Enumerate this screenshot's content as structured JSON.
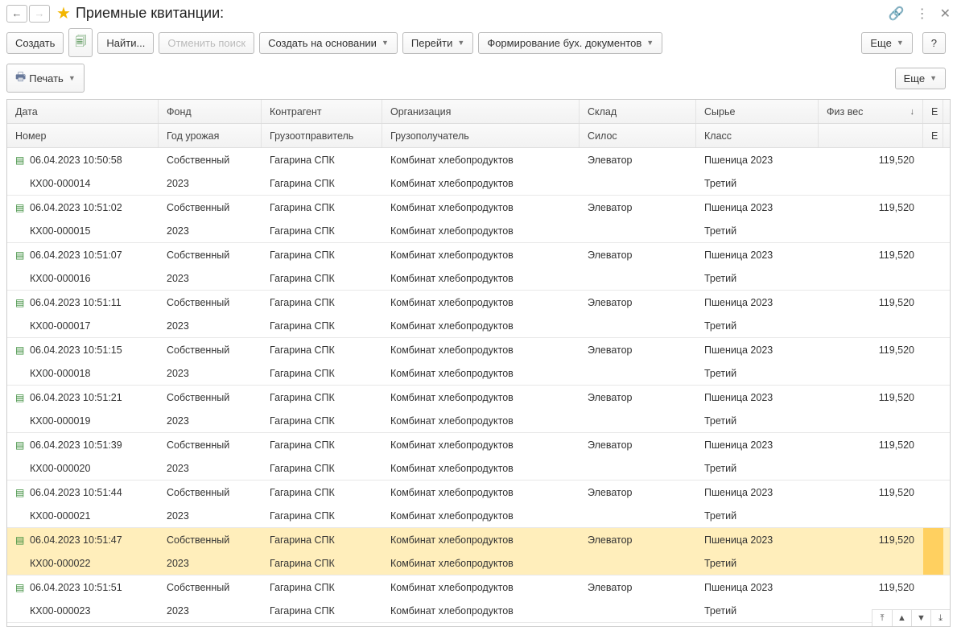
{
  "title": "Приемные квитанции:",
  "toolbar": {
    "create": "Создать",
    "find": "Найти...",
    "cancel_search": "Отменить поиск",
    "create_based": "Создать на основании",
    "goto": "Перейти",
    "form_docs": "Формирование бух. документов",
    "more": "Еще",
    "help": "?",
    "print": "Печать"
  },
  "headers": {
    "row1": {
      "c1": "Дата",
      "c2": "Фонд",
      "c3": "Контрагент",
      "c4": "Организация",
      "c5": "Склад",
      "c6": "Сырье",
      "c7": "Физ вес",
      "c8": "Е"
    },
    "row2": {
      "c1": "Номер",
      "c2": "Год урожая",
      "c3": "Грузоотправитель",
      "c4": "Грузополучатель",
      "c5": "Силос",
      "c6": "Класс",
      "c7": "",
      "c8": "Е"
    }
  },
  "rows": [
    {
      "date": "06.04.2023 10:50:58",
      "num": "КХ00-000014",
      "fund": "Собственный",
      "year": "2023",
      "counterparty": "Гагарина СПК",
      "sender": "Гагарина СПК",
      "org": "Комбинат хлебопродуктов",
      "receiver": "Комбинат хлебопродуктов",
      "warehouse": "Элеватор",
      "silo": "",
      "raw": "Пшеница 2023",
      "cls": "Третий",
      "weight": "119,520",
      "selected": false
    },
    {
      "date": "06.04.2023 10:51:02",
      "num": "КХ00-000015",
      "fund": "Собственный",
      "year": "2023",
      "counterparty": "Гагарина СПК",
      "sender": "Гагарина СПК",
      "org": "Комбинат хлебопродуктов",
      "receiver": "Комбинат хлебопродуктов",
      "warehouse": "Элеватор",
      "silo": "",
      "raw": "Пшеница 2023",
      "cls": "Третий",
      "weight": "119,520",
      "selected": false
    },
    {
      "date": "06.04.2023 10:51:07",
      "num": "КХ00-000016",
      "fund": "Собственный",
      "year": "2023",
      "counterparty": "Гагарина СПК",
      "sender": "Гагарина СПК",
      "org": "Комбинат хлебопродуктов",
      "receiver": "Комбинат хлебопродуктов",
      "warehouse": "Элеватор",
      "silo": "",
      "raw": "Пшеница 2023",
      "cls": "Третий",
      "weight": "119,520",
      "selected": false
    },
    {
      "date": "06.04.2023 10:51:11",
      "num": "КХ00-000017",
      "fund": "Собственный",
      "year": "2023",
      "counterparty": "Гагарина СПК",
      "sender": "Гагарина СПК",
      "org": "Комбинат хлебопродуктов",
      "receiver": "Комбинат хлебопродуктов",
      "warehouse": "Элеватор",
      "silo": "",
      "raw": "Пшеница 2023",
      "cls": "Третий",
      "weight": "119,520",
      "selected": false
    },
    {
      "date": "06.04.2023 10:51:15",
      "num": "КХ00-000018",
      "fund": "Собственный",
      "year": "2023",
      "counterparty": "Гагарина СПК",
      "sender": "Гагарина СПК",
      "org": "Комбинат хлебопродуктов",
      "receiver": "Комбинат хлебопродуктов",
      "warehouse": "Элеватор",
      "silo": "",
      "raw": "Пшеница 2023",
      "cls": "Третий",
      "weight": "119,520",
      "selected": false
    },
    {
      "date": "06.04.2023 10:51:21",
      "num": "КХ00-000019",
      "fund": "Собственный",
      "year": "2023",
      "counterparty": "Гагарина СПК",
      "sender": "Гагарина СПК",
      "org": "Комбинат хлебопродуктов",
      "receiver": "Комбинат хлебопродуктов",
      "warehouse": "Элеватор",
      "silo": "",
      "raw": "Пшеница 2023",
      "cls": "Третий",
      "weight": "119,520",
      "selected": false
    },
    {
      "date": "06.04.2023 10:51:39",
      "num": "КХ00-000020",
      "fund": "Собственный",
      "year": "2023",
      "counterparty": "Гагарина СПК",
      "sender": "Гагарина СПК",
      "org": "Комбинат хлебопродуктов",
      "receiver": "Комбинат хлебопродуктов",
      "warehouse": "Элеватор",
      "silo": "",
      "raw": "Пшеница 2023",
      "cls": "Третий",
      "weight": "119,520",
      "selected": false
    },
    {
      "date": "06.04.2023 10:51:44",
      "num": "КХ00-000021",
      "fund": "Собственный",
      "year": "2023",
      "counterparty": "Гагарина СПК",
      "sender": "Гагарина СПК",
      "org": "Комбинат хлебопродуктов",
      "receiver": "Комбинат хлебопродуктов",
      "warehouse": "Элеватор",
      "silo": "",
      "raw": "Пшеница 2023",
      "cls": "Третий",
      "weight": "119,520",
      "selected": false
    },
    {
      "date": "06.04.2023 10:51:47",
      "num": "КХ00-000022",
      "fund": "Собственный",
      "year": "2023",
      "counterparty": "Гагарина СПК",
      "sender": "Гагарина СПК",
      "org": "Комбинат хлебопродуктов",
      "receiver": "Комбинат хлебопродуктов",
      "warehouse": "Элеватор",
      "silo": "",
      "raw": "Пшеница 2023",
      "cls": "Третий",
      "weight": "119,520",
      "selected": true
    },
    {
      "date": "06.04.2023 10:51:51",
      "num": "КХ00-000023",
      "fund": "Собственный",
      "year": "2023",
      "counterparty": "Гагарина СПК",
      "sender": "Гагарина СПК",
      "org": "Комбинат хлебопродуктов",
      "receiver": "Комбинат хлебопродуктов",
      "warehouse": "Элеватор",
      "silo": "",
      "raw": "Пшеница 2023",
      "cls": "Третий",
      "weight": "119,520",
      "selected": false
    }
  ]
}
